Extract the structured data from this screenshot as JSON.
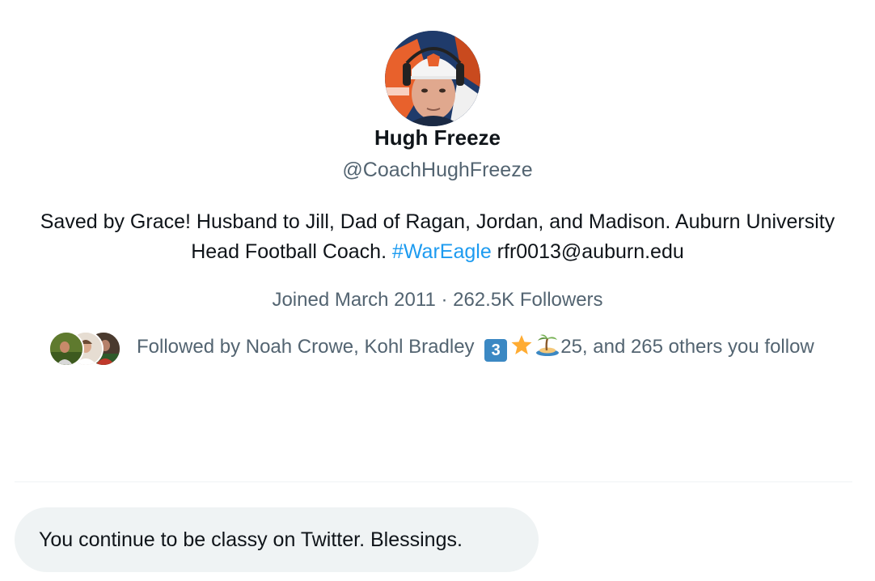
{
  "profile": {
    "name": "Hugh Freeze",
    "handle": "@CoachHughFreeze",
    "bio_part1": "Saved by Grace! Husband to Jill, Dad of Ragan, Jordan, and Madison. Auburn University Head Football Coach. ",
    "bio_hashtag": "#WarEagle",
    "bio_part2": " rfr0013@auburn.edu",
    "meta": "Joined March 2011 · 262.5K Followers",
    "followed_by_prefix": "Followed by Noah Crowe, Kohl Bradley ",
    "followed_by_emoji_number": "3",
    "followed_by_suffix": "25, and 265 others you follow",
    "avatar_icon": "profile-photo",
    "follower_avatar_icons": [
      "follower-avatar-1",
      "follower-avatar-2",
      "follower-avatar-3"
    ]
  },
  "reply": {
    "text": "You continue to be classy on Twitter. Blessings."
  },
  "colors": {
    "accent": "#1d9bf0",
    "secondary_text": "#536471",
    "primary_text": "#0f1419",
    "bubble_bg": "#eff3f4"
  }
}
